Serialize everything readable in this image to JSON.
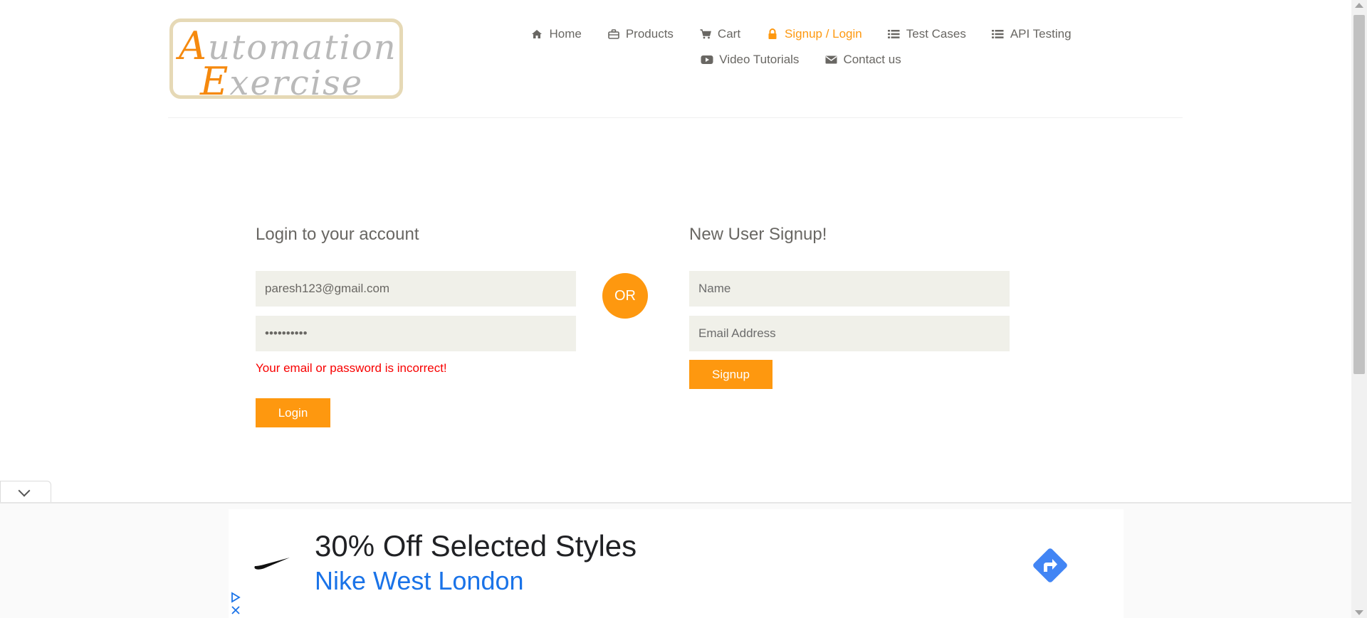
{
  "header": {
    "logo": {
      "line1_cap": "A",
      "line1_rest": "utomation",
      "line2_cap": "E",
      "line2_rest": "xercise"
    },
    "nav_row1": [
      {
        "label": "Home",
        "icon": "home-icon",
        "active": false
      },
      {
        "label": "Products",
        "icon": "briefcase-icon",
        "active": false
      },
      {
        "label": "Cart",
        "icon": "shopping-cart-icon",
        "active": false
      },
      {
        "label": "Signup / Login",
        "icon": "lock-icon",
        "active": true
      },
      {
        "label": "Test Cases",
        "icon": "list-icon",
        "active": false
      },
      {
        "label": "API Testing",
        "icon": "list-icon",
        "active": false
      }
    ],
    "nav_row2": [
      {
        "label": "Video Tutorials",
        "icon": "youtube-play-icon",
        "active": false
      },
      {
        "label": "Contact us",
        "icon": "envelope-icon",
        "active": false
      }
    ]
  },
  "login": {
    "title": "Login to your account",
    "email_value": "paresh123@gmail.com",
    "password_value": "••••••••••",
    "error": "Your email or password is incorrect!",
    "button": "Login"
  },
  "or_label": "OR",
  "signup": {
    "title": "New User Signup!",
    "name_placeholder": "Name",
    "email_placeholder": "Email Address",
    "button": "Signup"
  },
  "ad": {
    "headline": "30% Off Selected Styles",
    "subline": "Nike West London",
    "brand_icon": "nike-swoosh-icon",
    "cta_icon": "directions-icon"
  },
  "colors": {
    "accent": "#fe980f",
    "error": "#f80000",
    "text": "#696763",
    "field_bg": "#f0f0e9",
    "ad_link": "#1a73e8"
  }
}
